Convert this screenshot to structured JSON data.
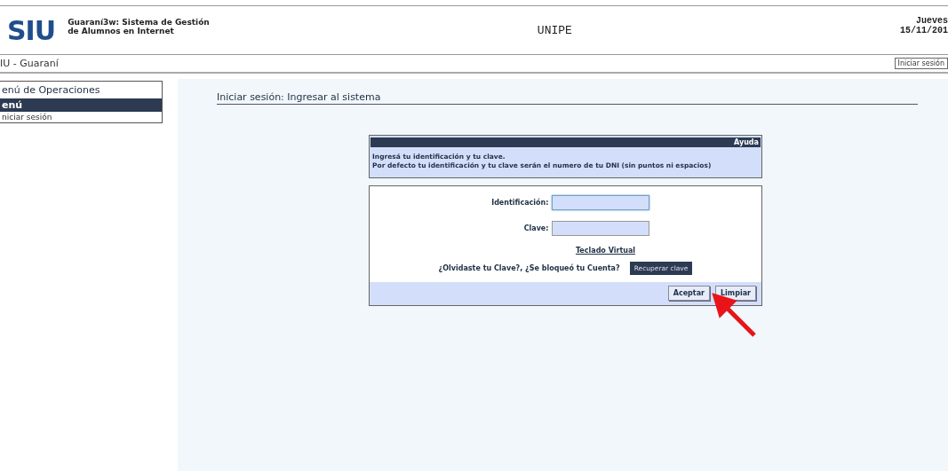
{
  "header": {
    "logo": "SIU",
    "system_name": "Guaraní3w: Sistema de Gestión\nde Alumnos en Internet",
    "institution": "UNIPE",
    "day": "Jueves",
    "date": "15/11/201"
  },
  "nav_bar": {
    "title": "IU - Guaraní",
    "login_button": "Iniciar sesión"
  },
  "sidebar": {
    "title": "enú de Operaciones",
    "section": "enú",
    "items": [
      {
        "label": "niciar sesión",
        "selected": false
      }
    ]
  },
  "main": {
    "heading": "Iniciar sesión: Ingresar al sistema",
    "help": {
      "title": "Ayuda",
      "lines": [
        "Ingresá tu identificación y tu clave.",
        "Por defecto tu identificación y tu clave serán el numero de tu DNI (sin puntos ni espacios)"
      ]
    },
    "form": {
      "fields": [
        {
          "label": "Identificación:",
          "focused": true
        },
        {
          "label": "Clave:",
          "focused": false
        }
      ],
      "virtual_keyboard_link": "Teclado Virtual",
      "recover_prompt": "¿Olvidaste tu Clave?, ¿Se bloqueó tu Cuenta?",
      "recover_button": "Recuperar clave",
      "buttons": [
        "Aceptar",
        "Limpiar"
      ]
    },
    "annotation": {
      "kind": "arrow",
      "color": "#e8141a"
    }
  }
}
